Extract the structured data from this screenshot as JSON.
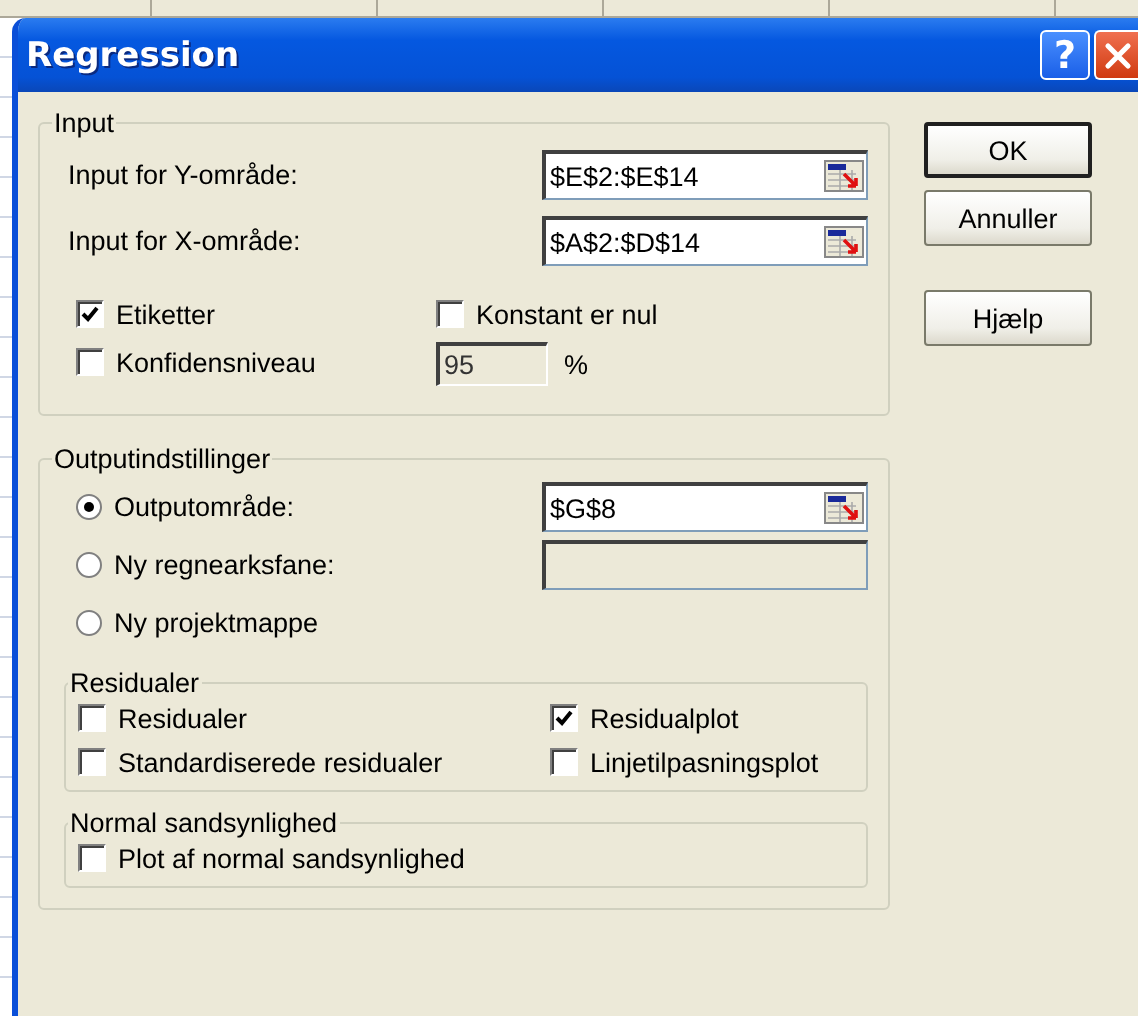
{
  "window": {
    "title": "Regression",
    "help_glyph": "?"
  },
  "input": {
    "title": "Input",
    "ranges": [
      {
        "label": "Input for Y-område:",
        "value": "$E$2:$E$14"
      },
      {
        "label": "Input for X-område:",
        "value": "$A$2:$D$14"
      }
    ],
    "options": [
      {
        "label": "Etiketter",
        "checked": true
      },
      {
        "label": "Konstant er nul",
        "checked": false
      },
      {
        "label": "Konfidensniveau",
        "checked": false
      }
    ],
    "confidence": {
      "value": "95",
      "unit": "%"
    }
  },
  "output": {
    "title": "Outputindstillinger",
    "destinations": [
      {
        "label": "Outputområde:",
        "selected": true,
        "kind": "range",
        "value": "$G$8"
      },
      {
        "label": "Ny regnearksfane:",
        "selected": false,
        "kind": "blank_field"
      },
      {
        "label": "Ny projektmappe",
        "selected": false,
        "kind": "none"
      }
    ],
    "residuals": {
      "title": "Residualer",
      "options": [
        {
          "label": "Residualer",
          "checked": false
        },
        {
          "label": "Residualplot",
          "checked": true
        },
        {
          "label": "Standardiserede residualer",
          "checked": false
        },
        {
          "label": "Linjetilpasningsplot",
          "checked": false
        }
      ]
    },
    "normal": {
      "title": "Normal sandsynlighed",
      "options": [
        {
          "label": "Plot af normal sandsynlighed",
          "checked": false
        }
      ]
    }
  },
  "buttons": [
    {
      "label": "OK",
      "default": true
    },
    {
      "label": "Annuller",
      "default": false
    },
    {
      "label": "Hjælp",
      "default": false
    }
  ]
}
